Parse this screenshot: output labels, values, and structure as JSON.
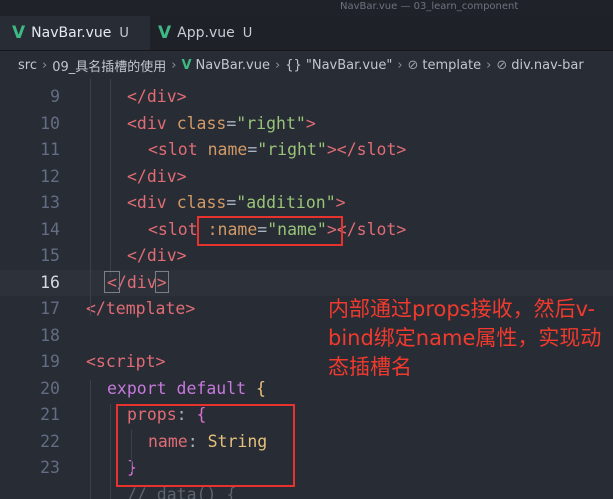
{
  "window": {
    "title": "NavBar.vue — 03_learn_component"
  },
  "tabs": [
    {
      "icon": "vue-icon",
      "label": "NavBar.vue",
      "status": "U"
    },
    {
      "icon": "vue-icon",
      "label": "App.vue",
      "status": "U"
    }
  ],
  "breadcrumb": {
    "items": [
      "src",
      "09_具名插槽的使用",
      "NavBar.vue",
      "{} \"NavBar.vue\"",
      "template",
      "div.nav-bar"
    ]
  },
  "editor": {
    "lines": [
      {
        "n": "9"
      },
      {
        "n": "10"
      },
      {
        "n": "11"
      },
      {
        "n": "12"
      },
      {
        "n": "13"
      },
      {
        "n": "14"
      },
      {
        "n": "15"
      },
      {
        "n": "16"
      },
      {
        "n": "17"
      },
      {
        "n": "18"
      },
      {
        "n": "19"
      },
      {
        "n": "20"
      },
      {
        "n": "21"
      },
      {
        "n": "22"
      },
      {
        "n": "23"
      }
    ],
    "current_line": "16",
    "tokens": {
      "l9_close_div": "</div>",
      "l10_div": "<div",
      "l10_class": "class",
      "l10_eq": "=",
      "l10_val": "\"right\"",
      "l10_gt": ">",
      "l11_slot": "<slot",
      "l11_name": "name",
      "l11_eq": "=",
      "l11_val": "\"right\"",
      "l11_gt": "></slot>",
      "l12_close": "</div>",
      "l13_div": "<div",
      "l13_class": "class",
      "l13_eq": "=",
      "l13_val": "\"addition\"",
      "l13_gt": ">",
      "l14_slot": "<slot",
      "l14_attr": ":name",
      "l14_eq": "=",
      "l14_val": "\"name\"",
      "l14_gt": "></slot>",
      "l15_close": "</div>",
      "l16_open": "</",
      "l16_div": "div",
      "l16_gt": ">",
      "l17_close": "</template>",
      "l19_script": "<script>",
      "l20_export": "export",
      "l20_default": "default",
      "l20_brace": "{",
      "l21_props": "props",
      "l21_colon": ":",
      "l21_brace": "{",
      "l22_name": "name",
      "l22_colon": ":",
      "l22_type": "String",
      "l23_brace": "}",
      "l24_partial": "// data() {"
    }
  },
  "annotation": {
    "text": "内部通过props接收，然后v-bind绑定name属性，实现动态插槽名"
  },
  "colors": {
    "highlight_box": "#e8322e",
    "annotation_text": "#f03a2e",
    "vue_icon": "#3fb984"
  }
}
